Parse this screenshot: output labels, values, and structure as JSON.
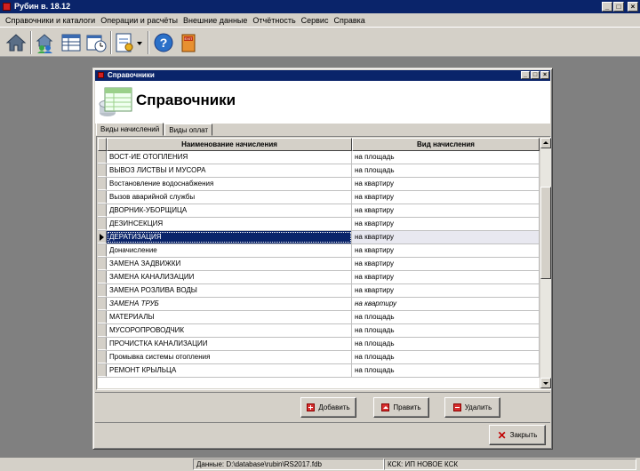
{
  "app": {
    "title": "Рубин в. 18.12"
  },
  "menu": [
    {
      "label": "Справочники и каталоги"
    },
    {
      "label": "Операции и расчёты"
    },
    {
      "label": "Внешние данные"
    },
    {
      "label": "Отчётность"
    },
    {
      "label": "Сервис"
    },
    {
      "label": "Справка"
    }
  ],
  "toolbar": {
    "icons": [
      "home-icon",
      "people-house-icon",
      "table-icon",
      "schedule-icon",
      "report-dropdown-icon",
      "help-icon",
      "exit-icon"
    ],
    "exit_label": "EXIT"
  },
  "window": {
    "title": "Справочники",
    "heading": "Справочники",
    "tabs": [
      {
        "label": "Виды начислений",
        "active": true
      },
      {
        "label": "Виды оплат",
        "active": false
      }
    ],
    "grid": {
      "columns": [
        "Наименование начисления",
        "Вид начисления"
      ],
      "rows": [
        {
          "name": "ВОСТ-ИЕ ОТОПЛЕНИЯ",
          "kind": "на площадь"
        },
        {
          "name": "ВЫВОЗ ЛИСТВЫ И МУСОРА",
          "kind": "на площадь"
        },
        {
          "name": "Востановление водоснабжения",
          "kind": "на квартиру"
        },
        {
          "name": "Вызов аварийной службы",
          "kind": "на квартиру"
        },
        {
          "name": "ДВОРНИК-УБОРЩИЦА",
          "kind": "на квартиру"
        },
        {
          "name": "ДЕЗИНСЕКЦИЯ",
          "kind": "на квартиру"
        },
        {
          "name": "ДЕРАТИЗАЦИЯ",
          "kind": "на квартиру",
          "selected": true
        },
        {
          "name": "Доначисление",
          "kind": "на квартиру"
        },
        {
          "name": "ЗАМЕНА ЗАДВИЖКИ",
          "kind": "на квартиру"
        },
        {
          "name": "ЗАМЕНА КАНАЛИЗАЦИИ",
          "kind": "на квартиру"
        },
        {
          "name": "ЗАМЕНА РОЗЛИВА ВОДЫ",
          "kind": "на квартиру"
        },
        {
          "name": "ЗАМЕНА ТРУБ",
          "kind": "на квартиру",
          "italic": true
        },
        {
          "name": "МАТЕРИАЛЫ",
          "kind": "на площадь"
        },
        {
          "name": "МУСОРОПРОВОДЧИК",
          "kind": "на площадь"
        },
        {
          "name": "ПРОЧИСТКА КАНАЛИЗАЦИИ",
          "kind": "на площадь"
        },
        {
          "name": "Промывка системы отопления",
          "kind": "на площадь"
        },
        {
          "name": "РЕМОНТ КРЫЛЬЦА",
          "kind": "на площадь"
        }
      ]
    },
    "buttons": {
      "add": "Добавить",
      "edit": "Править",
      "delete": "Удалить",
      "close": "Закрыть"
    }
  },
  "status": {
    "data_path": "Данные: D:\\database\\rubin\\RS2017.fdb",
    "ksk": "КСК: ИП НОВОЕ КСК"
  },
  "colors": {
    "titlebar": "#0a246a",
    "face": "#d4d0c8",
    "desktop": "#808080",
    "accent_red": "#d83030"
  }
}
